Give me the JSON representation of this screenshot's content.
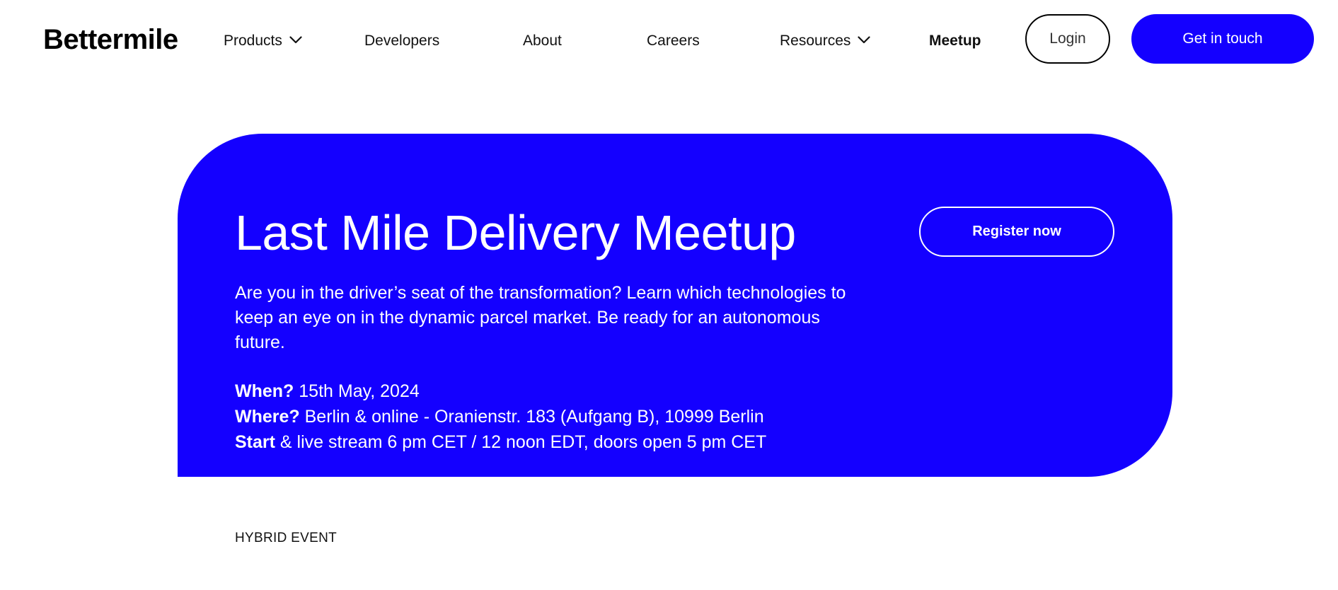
{
  "header": {
    "logo": "Bettermile",
    "nav": [
      {
        "label": "Products",
        "has_dropdown": true
      },
      {
        "label": "Developers",
        "has_dropdown": false
      },
      {
        "label": "About",
        "has_dropdown": false
      },
      {
        "label": "Careers",
        "has_dropdown": false
      },
      {
        "label": "Resources",
        "has_dropdown": true
      },
      {
        "label": "Meetup",
        "has_dropdown": false,
        "active": true
      }
    ],
    "login_label": "Login",
    "cta_label": "Get in touch"
  },
  "hero": {
    "title": "Last Mile Delivery Meetup",
    "description": "Are you in the driver’s seat of the transformation? Learn which technologies to keep an eye on in the dynamic parcel market. Be ready for an autonomous future.",
    "register_label": "Register now",
    "details": {
      "when_label": "When?",
      "when_value": " 15th May, 2024",
      "where_label": "Where?",
      "where_value": " Berlin & online - Oranienstr. 183 (Aufgang B), 10999 Berlin",
      "start_label": "Start",
      "start_value": " & live stream 6 pm CET / 12 noon EDT, doors open 5 pm CET"
    }
  },
  "event_type": "HYBRID EVENT",
  "colors": {
    "brand_blue": "#1400ff",
    "text": "#000000",
    "background": "#ffffff"
  },
  "icons": {
    "dropdown": "chevron-down-icon"
  }
}
